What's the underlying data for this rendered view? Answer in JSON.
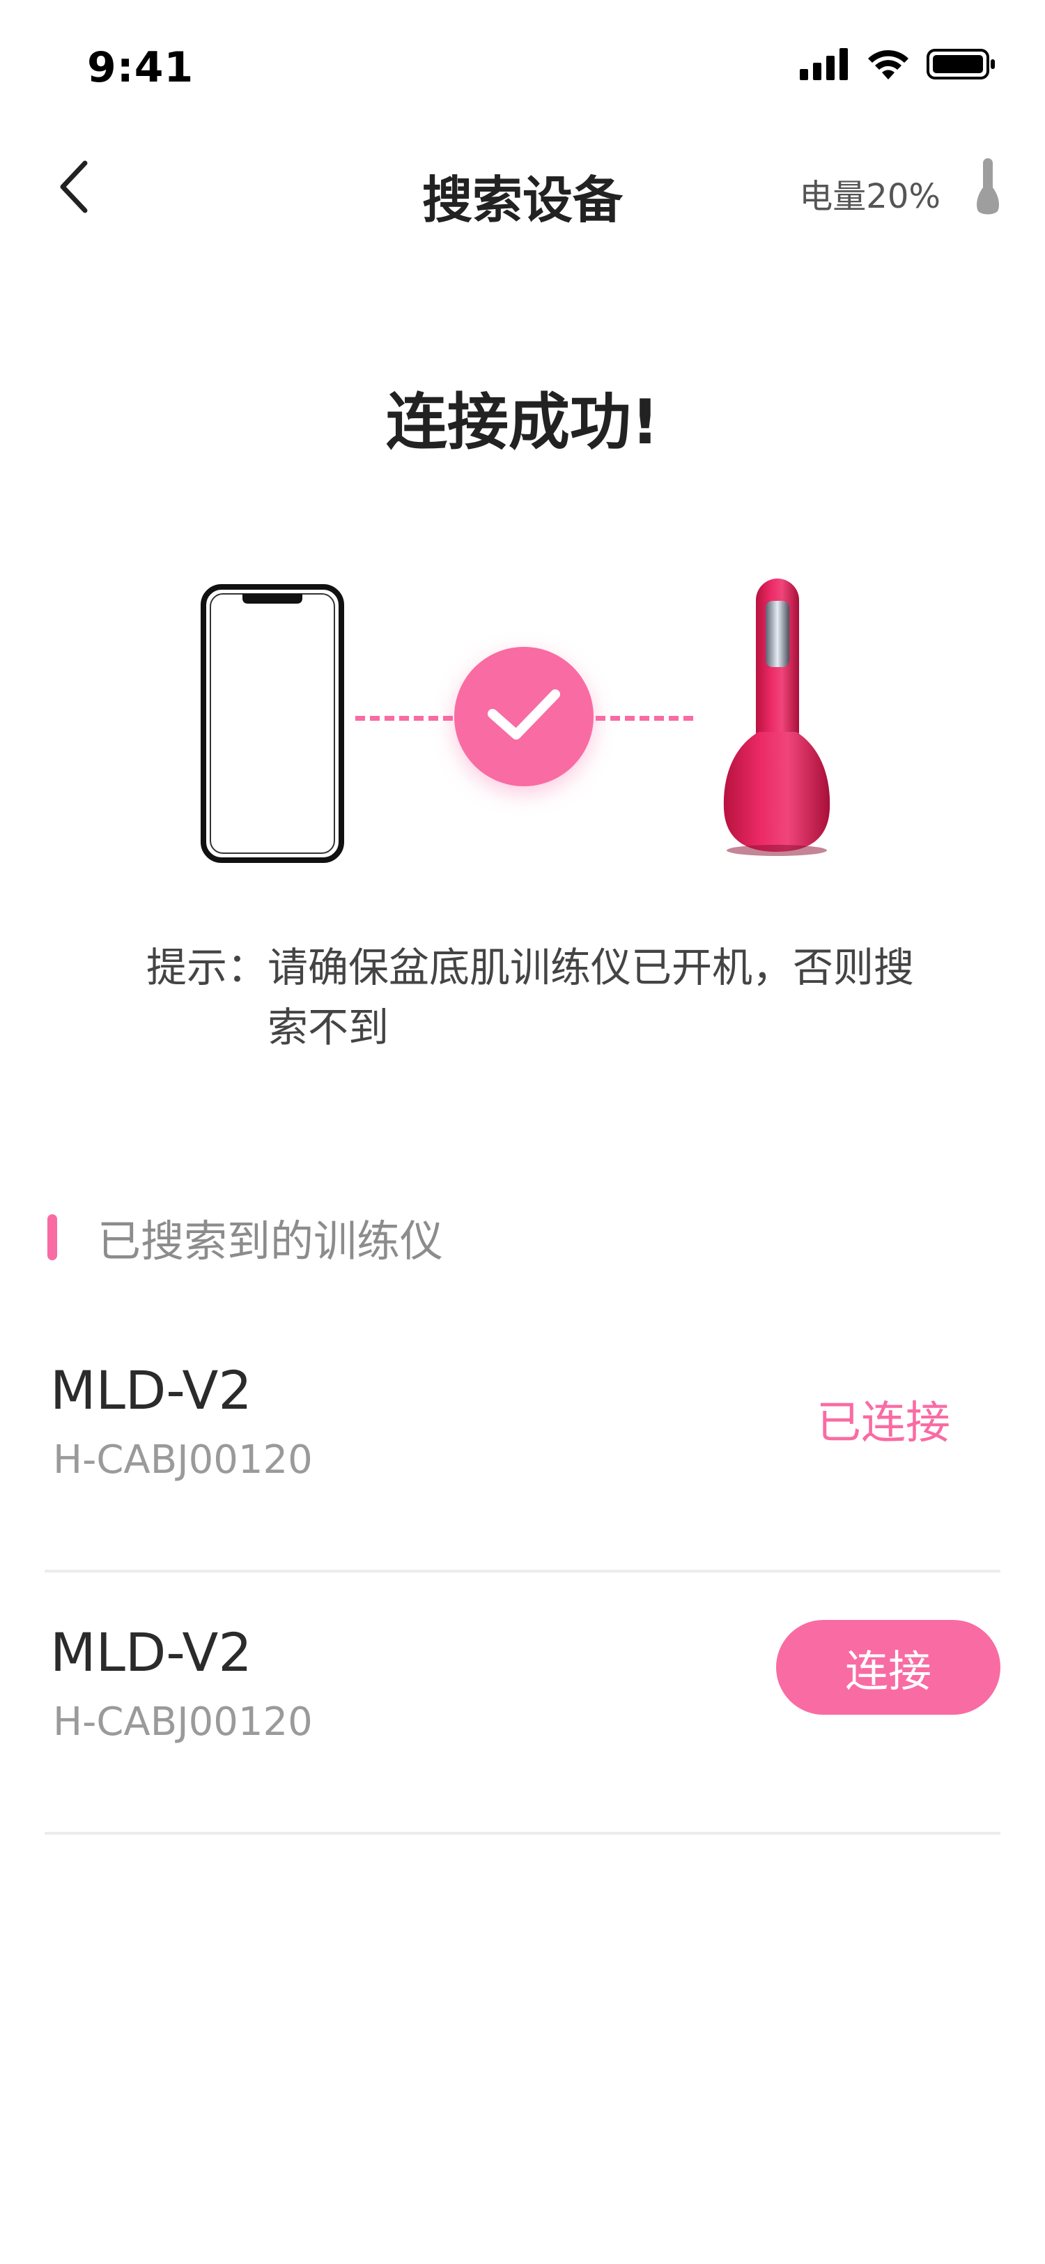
{
  "status_bar": {
    "time": "9:41"
  },
  "nav": {
    "title": "搜索设备",
    "battery": "电量20%"
  },
  "success": {
    "title": "连接成功!"
  },
  "tip": {
    "label": "提示：",
    "text": "请确保盆底肌训练仪已开机，否则搜索不到"
  },
  "section": {
    "title": "已搜索到的训练仪"
  },
  "devices": [
    {
      "name": "MLD-V2",
      "serial": "H-CABJ00120",
      "status": "已连接"
    },
    {
      "name": "MLD-V2",
      "serial": "H-CABJ00120",
      "action": "连接"
    }
  ],
  "colors": {
    "accent": "#f96ba3",
    "device": "#e8245f"
  },
  "icons": {
    "back": "chevron-left-icon",
    "signal": "cellular-signal-icon",
    "wifi": "wifi-icon",
    "battery": "battery-icon",
    "device": "trainer-device-icon",
    "check": "checkmark-icon"
  }
}
